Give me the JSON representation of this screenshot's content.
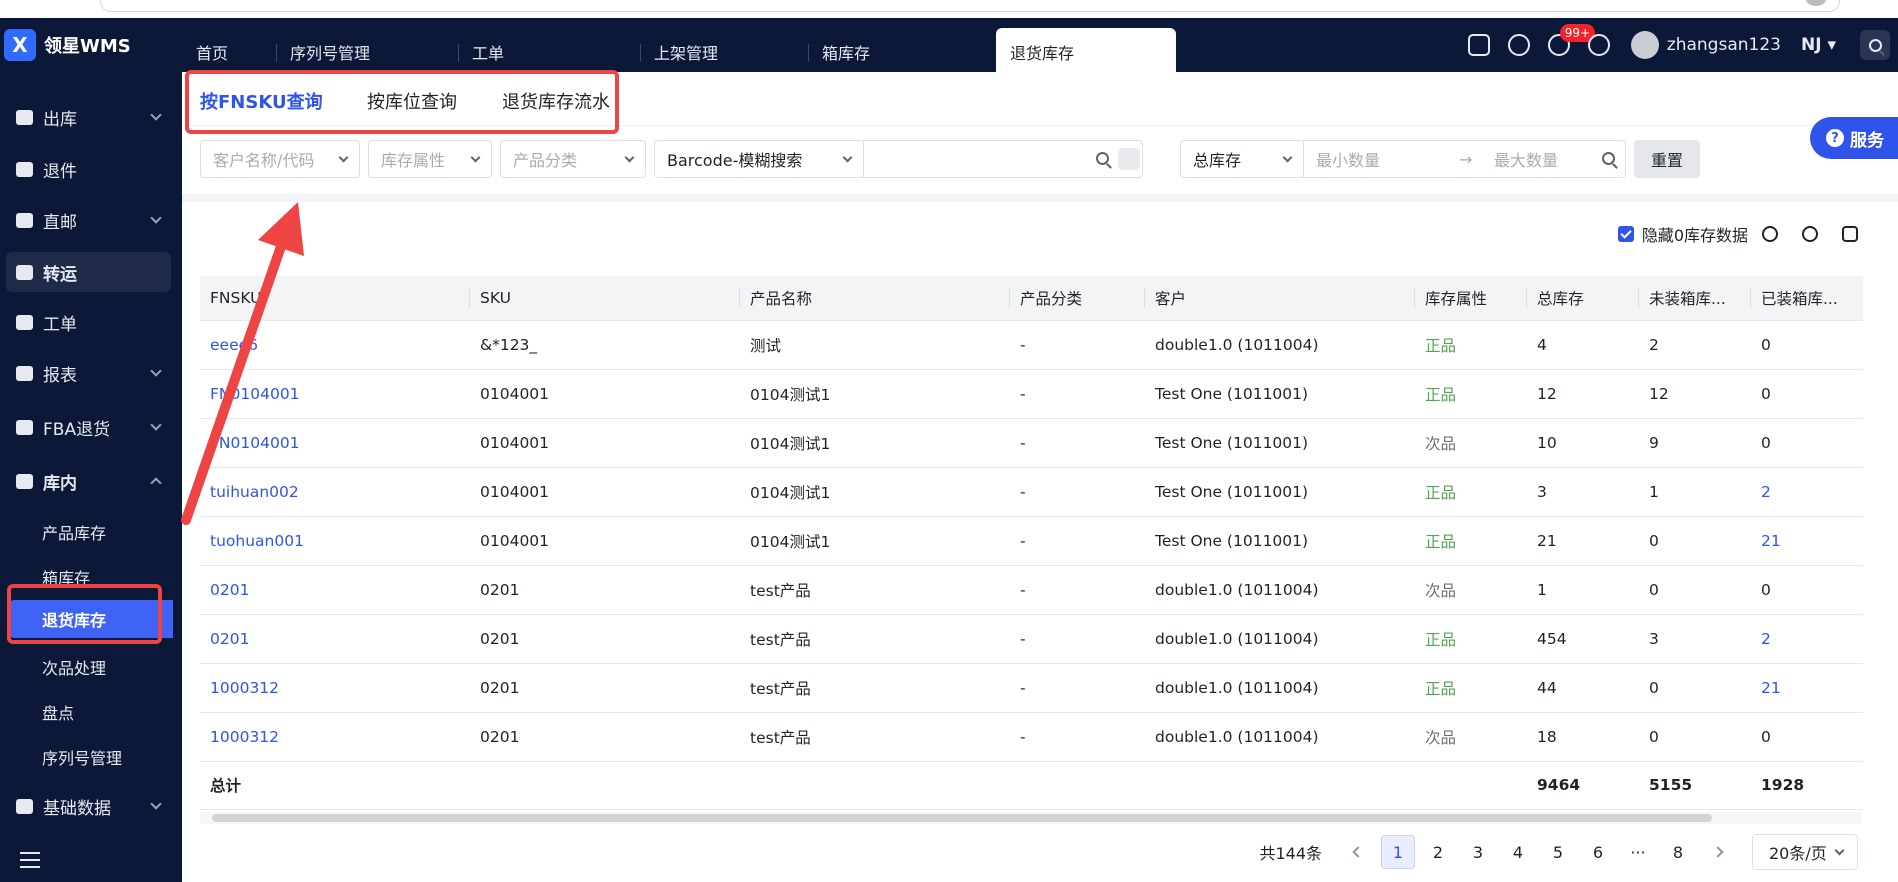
{
  "app": {
    "logo_text": "领星WMS",
    "logo_glyph": "X"
  },
  "top_tabs": [
    {
      "label": "首页"
    },
    {
      "label": "序列号管理"
    },
    {
      "label": "工单"
    },
    {
      "label": "上架管理"
    },
    {
      "label": "箱库存"
    },
    {
      "label": "退货库存",
      "active": true
    }
  ],
  "topbar": {
    "notification_badge": "99+",
    "username": "zhangsan123",
    "warehouse": "NJ ▾"
  },
  "sidebar": {
    "items": [
      {
        "label": "出库"
      },
      {
        "label": "退件"
      },
      {
        "label": "直邮"
      },
      {
        "label": "转运"
      },
      {
        "label": "工单"
      },
      {
        "label": "报表"
      },
      {
        "label": "FBA退货"
      },
      {
        "label": "库内"
      },
      {
        "label": "基础数据"
      }
    ],
    "sub_items": [
      {
        "label": "产品库存"
      },
      {
        "label": "箱库存"
      },
      {
        "label": "退货库存",
        "active": true
      },
      {
        "label": "次品处理"
      },
      {
        "label": "盘点"
      },
      {
        "label": "序列号管理"
      }
    ]
  },
  "subtabs": [
    {
      "label": "按FNSKU查询",
      "active": true
    },
    {
      "label": "按库位查询"
    },
    {
      "label": "退货库存流水"
    }
  ],
  "filters": {
    "customer_placeholder": "客户名称/代码",
    "attr_placeholder": "库存属性",
    "category_placeholder": "产品分类",
    "search_mode": "Barcode-模糊搜索",
    "stock_type": "总库存",
    "min_placeholder": "最小数量",
    "max_placeholder": "最大数量",
    "reset_label": "重置",
    "arrow": "→"
  },
  "service_label": "服务",
  "toolbar": {
    "hide_zero_label": "隐藏0库存数据"
  },
  "table": {
    "columns": [
      "FNSKU",
      "SKU",
      "产品名称",
      "产品分类",
      "客户",
      "库存属性",
      "总库存",
      "未装箱库...",
      "已装箱库..."
    ],
    "rows": [
      [
        "eeee6",
        "&*123_",
        "测试",
        "-",
        "double1.0 (1011004)",
        "正品",
        "4",
        "2",
        "0"
      ],
      [
        "FN0104001",
        "0104001",
        "0104测试1",
        "-",
        "Test One (1011001)",
        "正品",
        "12",
        "12",
        "0"
      ],
      [
        "FN0104001",
        "0104001",
        "0104测试1",
        "-",
        "Test One (1011001)",
        "次品",
        "10",
        "9",
        "0"
      ],
      [
        "tuihuan002",
        "0104001",
        "0104测试1",
        "-",
        "Test One (1011001)",
        "正品",
        "3",
        "1",
        "2"
      ],
      [
        "tuohuan001",
        "0104001",
        "0104测试1",
        "-",
        "Test One (1011001)",
        "正品",
        "21",
        "0",
        "21"
      ],
      [
        "0201",
        "0201",
        "test产品",
        "-",
        "double1.0 (1011004)",
        "次品",
        "1",
        "0",
        "0"
      ],
      [
        "0201",
        "0201",
        "test产品",
        "-",
        "double1.0 (1011004)",
        "正品",
        "454",
        "3",
        "2"
      ],
      [
        "1000312",
        "0201",
        "test产品",
        "-",
        "double1.0 (1011004)",
        "正品",
        "44",
        "0",
        "21"
      ],
      [
        "1000312",
        "0201",
        "test产品",
        "-",
        "double1.0 (1011004)",
        "次品",
        "18",
        "0",
        "0"
      ]
    ],
    "total": {
      "label": "总计",
      "total_stock": "9464",
      "unboxed": "5155",
      "boxed": "1928"
    }
  },
  "pagination": {
    "total_label": "共144条",
    "pages": [
      "1",
      "2",
      "3",
      "4",
      "5",
      "6",
      "···",
      "8"
    ],
    "current": "1",
    "page_size": "20条/页"
  },
  "colors": {
    "accent": "#2f54eb",
    "nav_bg": "#0c1838",
    "good": "#52a552",
    "annotation": "#ee4444"
  }
}
